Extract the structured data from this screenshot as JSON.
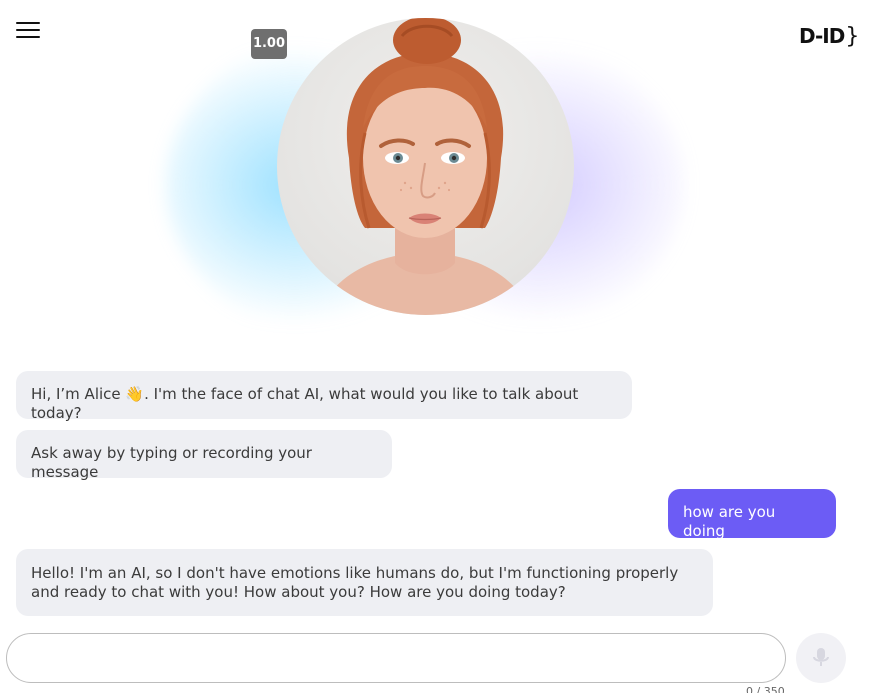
{
  "header": {
    "menu_icon": "hamburger-menu-icon",
    "logo_text": "D-ID",
    "logo_brace": "}"
  },
  "avatar": {
    "speed_label": "1.00"
  },
  "chat": {
    "messages": [
      {
        "role": "assistant",
        "text": "Hi, I’m Alice 👋. I'm the face of chat AI, what would you like to talk about today?"
      },
      {
        "role": "assistant",
        "text": "Ask away by typing or recording your message"
      },
      {
        "role": "user",
        "text": "how are you doing"
      },
      {
        "role": "assistant",
        "text": "Hello! I'm an AI, so I don't have emotions like humans do, but I'm functioning properly and ready to chat with you! How about you? How are you doing today?"
      }
    ]
  },
  "composer": {
    "placeholder": "",
    "value": "",
    "counter": "0 / 350",
    "mic_icon": "microphone-icon"
  },
  "colors": {
    "user_bubble": "#6c5cf5",
    "assistant_bubble": "#eeeff3"
  }
}
